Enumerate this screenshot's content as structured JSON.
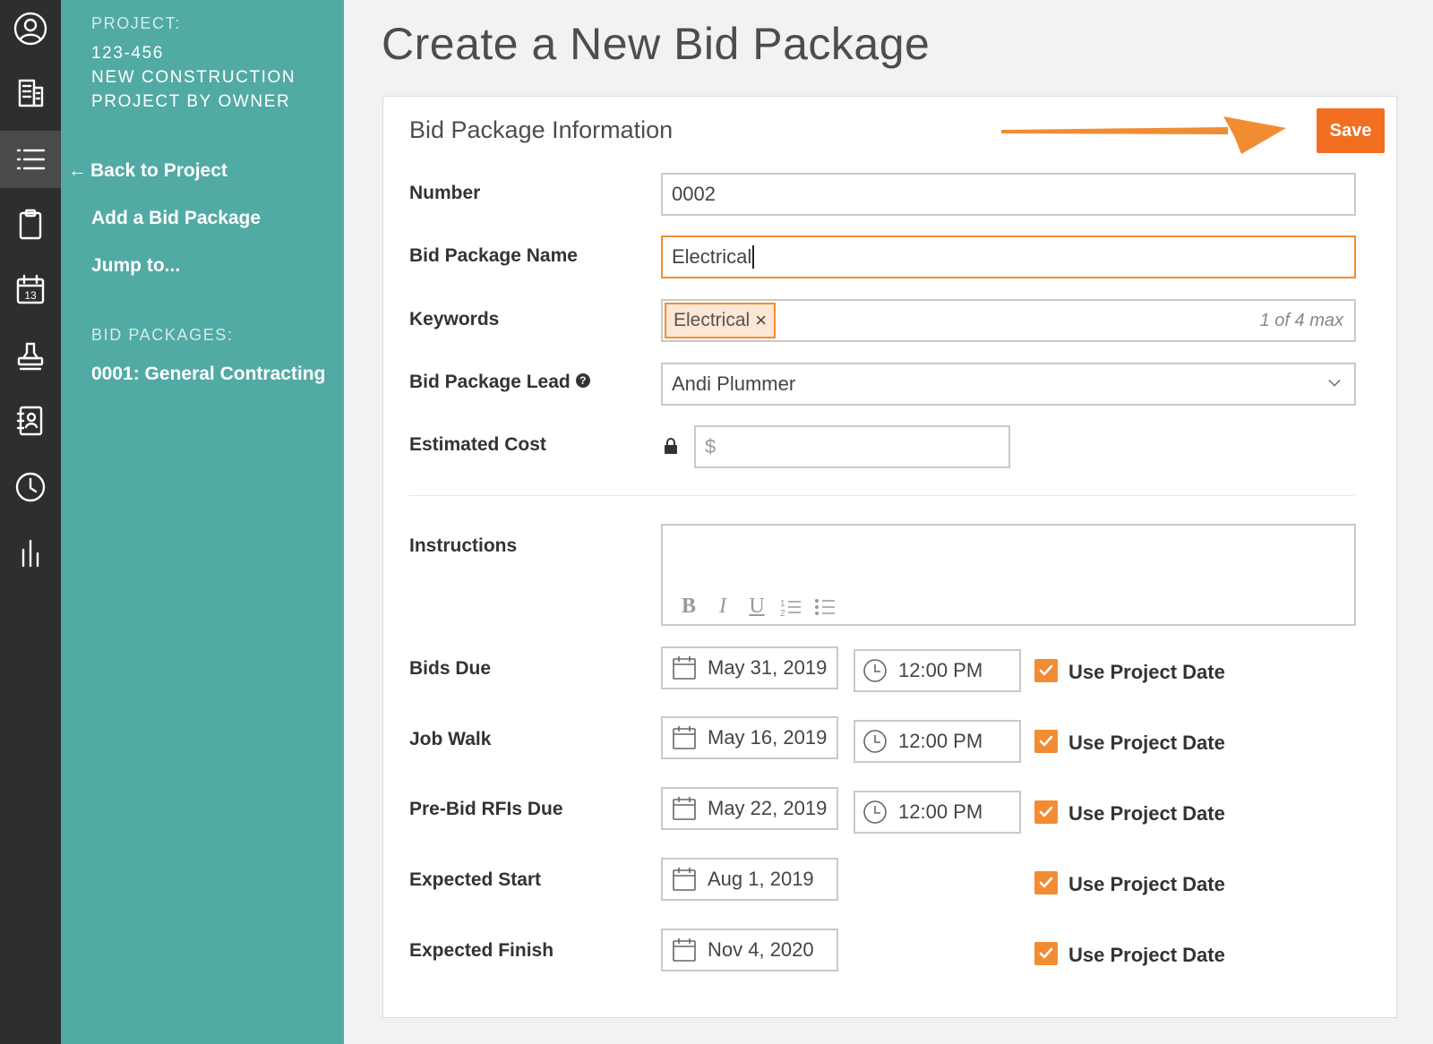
{
  "rail": {
    "icons": [
      "user-circle-icon",
      "building-icon",
      "list-icon",
      "clipboard-icon",
      "calendar-icon",
      "stamp-icon",
      "contact-book-icon",
      "clock-icon",
      "bar-chart-icon"
    ],
    "calendar_day": "13"
  },
  "sidebar": {
    "project_label": "PROJECT:",
    "project_number": "123-456",
    "project_name_line1": "NEW CONSTRUCTION",
    "project_name_line2": "PROJECT BY OWNER",
    "back_arrow": "←",
    "back_link": "Back to Project",
    "add_link": "Add a Bid Package",
    "jump_link": "Jump to...",
    "packages_label": "BID PACKAGES:",
    "packages": [
      "0001: General Contracting"
    ]
  },
  "page": {
    "title": "Create a New Bid Package"
  },
  "form": {
    "section_title": "Bid Package Information",
    "save_label": "Save",
    "number": {
      "label": "Number",
      "value": "0002"
    },
    "name": {
      "label": "Bid Package Name",
      "value": "Electrical"
    },
    "keywords": {
      "label": "Keywords",
      "tags": [
        "Electrical"
      ],
      "remove_glyph": "×",
      "count_note": "1 of 4 max"
    },
    "lead": {
      "label": "Bid Package Lead",
      "help_glyph": "?",
      "value": "Andi Plummer"
    },
    "cost": {
      "label": "Estimated Cost",
      "placeholder": "$"
    },
    "instructions": {
      "label": "Instructions",
      "toolbar": [
        "B",
        "I",
        "U"
      ]
    },
    "dates": [
      {
        "label": "Bids Due",
        "date": "May 31, 2019",
        "time": "12:00 PM",
        "checkbox": "Use Project Date",
        "checked": true
      },
      {
        "label": "Job Walk",
        "date": "May 16, 2019",
        "time": "12:00 PM",
        "checkbox": "Use Project Date",
        "checked": true
      },
      {
        "label": "Pre-Bid RFIs Due",
        "date": "May 22, 2019",
        "time": "12:00 PM",
        "checkbox": "Use Project Date",
        "checked": true
      },
      {
        "label": "Expected Start",
        "date": "Aug 1, 2019",
        "checkbox": "Use Project Date",
        "checked": true
      },
      {
        "label": "Expected Finish",
        "date": "Nov 4, 2020",
        "checkbox": "Use Project Date",
        "checked": true
      }
    ]
  },
  "colors": {
    "accent": "#f26f21",
    "sidebar": "#52aaa4",
    "rail": "#2e2e2e"
  }
}
